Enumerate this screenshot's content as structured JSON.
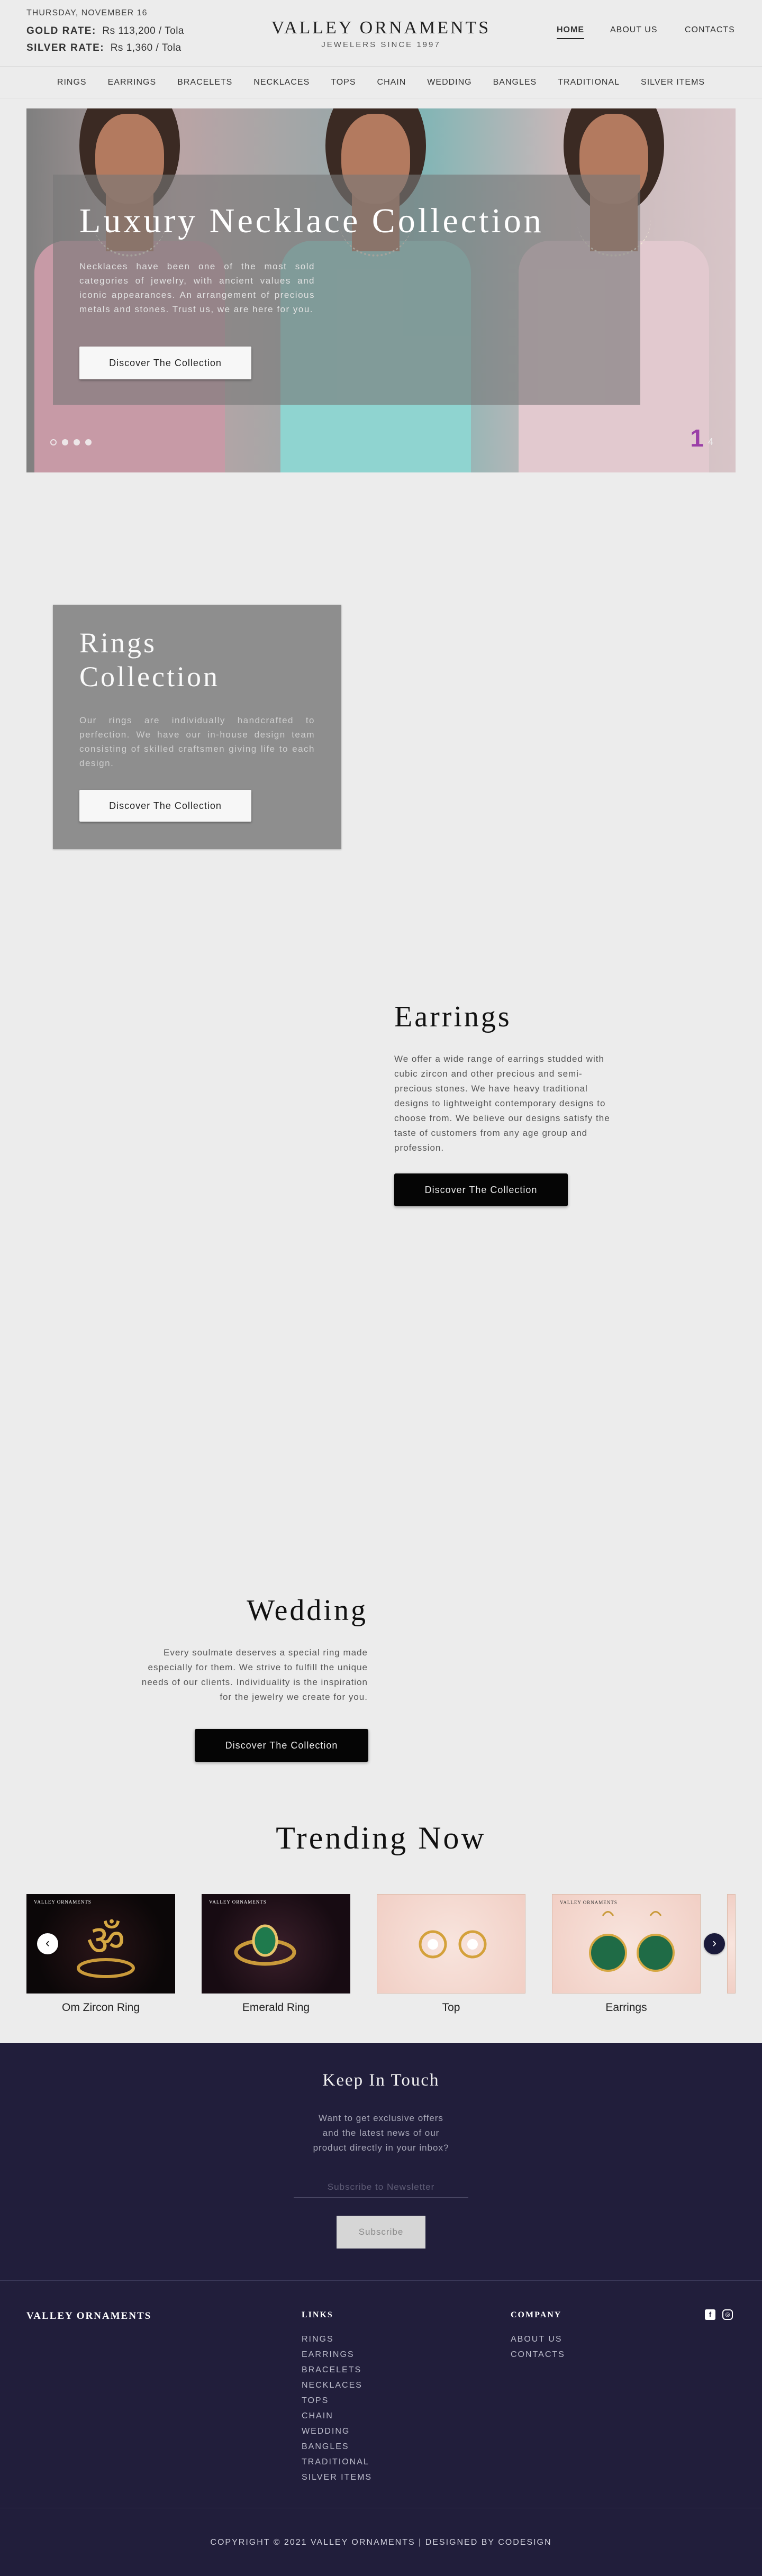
{
  "header": {
    "date": "THURSDAY, NOVEMBER 16",
    "gold_label": "GOLD RATE:",
    "gold_value": "Rs 113,200 / Tola",
    "silver_label": "SILVER RATE:",
    "silver_value": "Rs 1,360 / Tola",
    "brand": "VALLEY ORNAMENTS",
    "tagline": "JEWELERS SINCE 1997",
    "nav": [
      "HOME",
      "ABOUT US",
      "CONTACTS"
    ],
    "active_nav": "HOME"
  },
  "categories": [
    "RINGS",
    "EARRINGS",
    "BRACELETS",
    "NECKLACES",
    "TOPS",
    "CHAIN",
    "WEDDING",
    "BANGLES",
    "TRADITIONAL",
    "SILVER ITEMS"
  ],
  "hero": {
    "title": "Luxury Necklace Collection",
    "text": "Necklaces have been one of the most sold categories of jewelry, with ancient values and iconic appearances. An arrangement of precious metals and stones. Trust us, we are here for you.",
    "button": "Discover The Collection",
    "slide_number": "1",
    "slide_count": "4"
  },
  "rings": {
    "title": "Rings Collection",
    "text": "Our rings are individually handcrafted to perfection. We have our in-house design team consisting of skilled craftsmen giving life to each design.",
    "button": "Discover The Collection"
  },
  "earrings": {
    "title": "Earrings",
    "text": "We offer a wide range of earrings studded with cubic zircon and other precious and semi-precious stones. We have heavy traditional designs to lightweight contemporary designs to choose from. We believe our designs satisfy the taste of customers from any age group and profession.",
    "button": "Discover The Collection"
  },
  "wedding": {
    "title": "Wedding",
    "text": "Every soulmate deserves a special ring made especially for them. We strive to fulfill the unique needs of our clients. Individuality is the inspiration for the jewelry we create for you.",
    "button": "Discover The Collection"
  },
  "trending": {
    "title": "Trending Now",
    "card_brand": "VALLEY ORNAMENTS",
    "items": [
      {
        "label": "Om Zircon Ring"
      },
      {
        "label": "Emerald Ring"
      },
      {
        "label": "Top"
      },
      {
        "label": "Earrings"
      }
    ]
  },
  "newsletter": {
    "title": "Keep In Touch",
    "text": "Want to get exclusive offers and the latest news of our product directly in your inbox?",
    "placeholder": "Subscribe to Newsletter",
    "button": "Subscribe"
  },
  "footer": {
    "brand": "VALLEY ORNAMENTS",
    "links_heading": "LINKS",
    "links": [
      "RINGS",
      "EARRINGS",
      "BRACELETS",
      "NECKLACES",
      "TOPS",
      "CHAIN",
      "WEDDING",
      "BANGLES",
      "TRADITIONAL",
      "SILVER ITEMS"
    ],
    "company_heading": "COMPANY",
    "company": [
      "ABOUT US",
      "CONTACTS"
    ],
    "social": [
      {
        "icon": "facebook-icon",
        "glyph": "f"
      },
      {
        "icon": "instagram-icon",
        "glyph": "◎"
      }
    ],
    "copyright": "COPYRIGHT © 2021 VALLEY ORNAMENTS | DESIGNED BY CODESIGN"
  },
  "colors": {
    "background": "#ececec",
    "footer_bg": "#211e3b",
    "slide_accent": "#9b3fa8",
    "button_dark": "#050505"
  }
}
